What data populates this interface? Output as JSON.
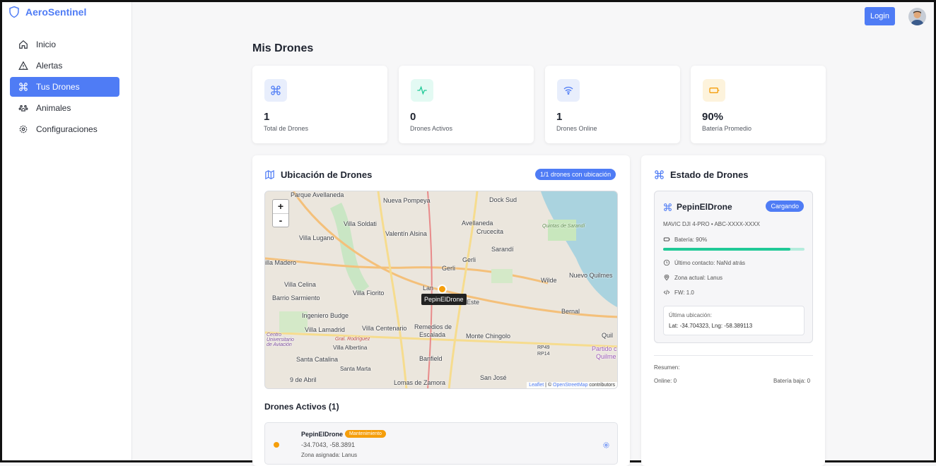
{
  "app": {
    "brand": "AeroSentinel"
  },
  "colors": {
    "accent": "#4f7cf5",
    "warning": "#f59e0b",
    "success": "#20c997"
  },
  "header": {
    "login_label": "Login"
  },
  "sidebar": {
    "items": [
      {
        "label": "Inicio",
        "icon": "home-icon"
      },
      {
        "label": "Alertas",
        "icon": "alert-triangle-icon"
      },
      {
        "label": "Tus Drones",
        "icon": "drone-icon",
        "active": true
      },
      {
        "label": "Animales",
        "icon": "paw-icon"
      },
      {
        "label": "Configuraciones",
        "icon": "gear-icon"
      }
    ]
  },
  "main": {
    "title": "Mis Drones",
    "stats": [
      {
        "value": "1",
        "label": "Total de Drones",
        "icon": "drone-icon"
      },
      {
        "value": "0",
        "label": "Drones Activos",
        "icon": "activity-icon"
      },
      {
        "value": "1",
        "label": "Drones Online",
        "icon": "wifi-icon"
      },
      {
        "value": "90%",
        "label": "Batería Promedio",
        "icon": "battery-icon"
      }
    ],
    "map_card": {
      "title": "Ubicación de Drones",
      "badge": "1/1 drones con ubicación",
      "zoom_in": "+",
      "zoom_out": "-",
      "marker_label": "PepinElDrone",
      "attribution_leaflet": "Leaflet",
      "attribution_sep": " | © ",
      "attribution_osm": "OpenStreetMap",
      "attribution_rest": " contributors",
      "labels": [
        "Parque Avellaneda",
        "Nueva Pompeya",
        "Dock Sud",
        "Villa Soldati",
        "Avellaneda",
        "Villa Lugano",
        "Valentín Alsina",
        "Crucecita",
        "Sarandí",
        "Gerli",
        "illa Madero",
        "Gerli",
        "Nuevo Quilmes",
        "Wilde",
        "Villa Celina",
        "Villa Fiorito",
        "Lan",
        "Barrio Sarmiento",
        "Este",
        "Bernal",
        "Ingeniero Budge",
        "Remedios de",
        "Escalada",
        "Villa Lamadrid",
        "Villa Centenario",
        "Monte Chingolo",
        "Quil",
        "Gral. Rodríguez",
        "Villa Albertina",
        "Partido c",
        "Quilme",
        "Santa Catalina",
        "Banfield",
        "Santa Marta",
        "San José",
        "9 de Abril",
        "Lomas de Zamora",
        "RP49",
        "RP14",
        "Quintas de Sarandí",
        "Centro Universitario de Aviación"
      ]
    },
    "active_section": {
      "title": "Drones Activos (1)",
      "row": {
        "name": "PepinElDrone",
        "badge": "Mantenimiento",
        "coords": "-34.7043, -58.3891",
        "zone": "Zona asignada: Lanus"
      }
    },
    "state_card": {
      "title": "Estado de Drones",
      "drone": {
        "name": "PepinElDrone",
        "status": "Cargando",
        "model": "MAVIC DJI 4-PRO • ABC-XXXX-XXXX",
        "battery_label": "Batería: 90%",
        "battery_pct": 90,
        "last_contact": "Último contacto: NaNd atrás",
        "zone": "Zona actual: Lanus",
        "fw": "FW: 1.0",
        "last_location_label": "Última ubicación:",
        "last_location_value": "Lat: -34.704323, Lng: -58.389113"
      },
      "summary": {
        "title": "Resumen:",
        "online": "Online: 0",
        "low_battery": "Batería baja: 0"
      }
    }
  }
}
